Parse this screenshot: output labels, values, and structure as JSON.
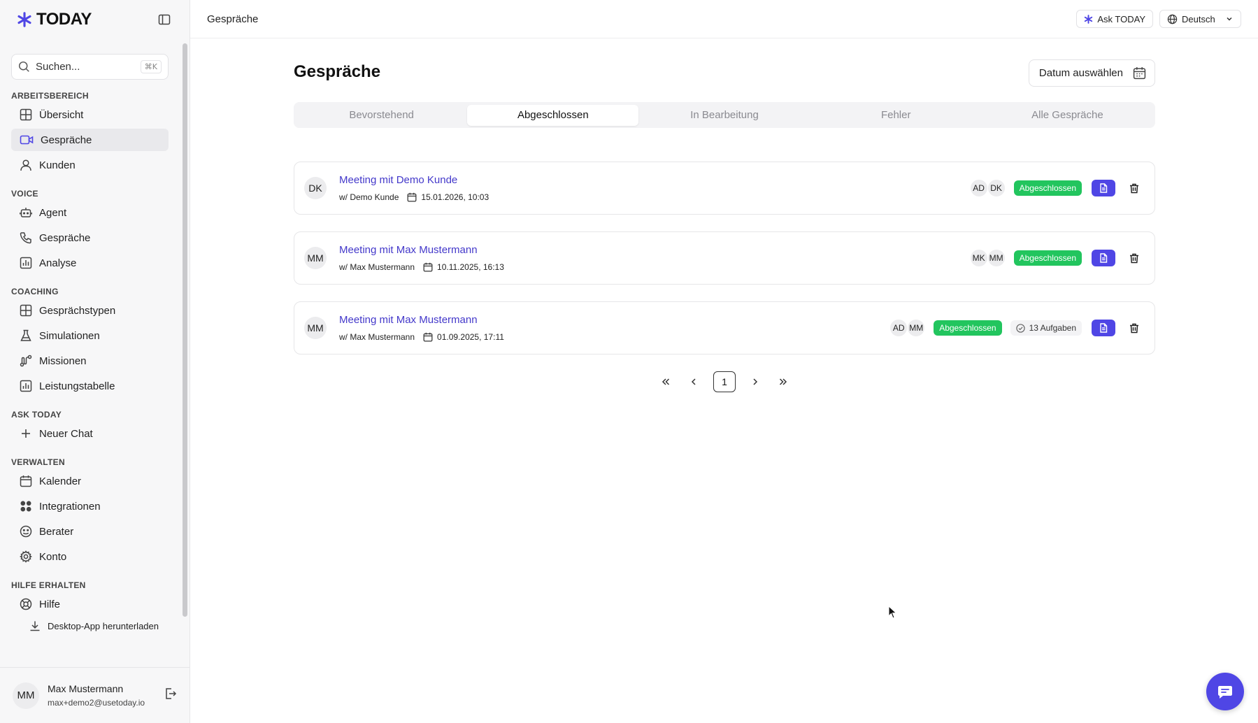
{
  "brand": {
    "name": "TODAY",
    "accent": "#4f46e5"
  },
  "topbar": {
    "breadcrumb": "Gespräche",
    "ask_label": "Ask TODAY",
    "language": "Deutsch"
  },
  "sidebar": {
    "search": {
      "placeholder": "Suchen...",
      "shortcut": "⌘K"
    },
    "sections": [
      {
        "title": "ARBEITSBEREICH",
        "items": [
          "Übersicht",
          "Gespräche",
          "Kunden"
        ]
      },
      {
        "title": "VOICE",
        "items": [
          "Agent",
          "Gespräche",
          "Analyse"
        ]
      },
      {
        "title": "COACHING",
        "items": [
          "Gesprächstypen",
          "Simulationen",
          "Missionen",
          "Leistungstabelle"
        ]
      },
      {
        "title": "ASK TODAY",
        "items": [
          "Neuer Chat"
        ]
      },
      {
        "title": "VERWALTEN",
        "items": [
          "Kalender",
          "Integrationen",
          "Berater",
          "Konto"
        ]
      },
      {
        "title": "HILFE ERHALTEN",
        "items": [
          "Hilfe",
          "Desktop-App herunterladen"
        ]
      }
    ],
    "user": {
      "initials": "MM",
      "name": "Max Mustermann",
      "email": "max+demo2@usetoday.io"
    }
  },
  "main": {
    "title": "Gespräche",
    "date_button": "Datum auswählen",
    "tabs": [
      "Bevorstehend",
      "Abgeschlossen",
      "In Bearbeitung",
      "Fehler",
      "Alle Gespräche"
    ],
    "active_tab": "Abgeschlossen",
    "meetings": [
      {
        "initials": "DK",
        "title": "Meeting mit Demo Kunde",
        "with": "w/ Demo Kunde",
        "datetime": "15.01.2026, 10:03",
        "participants": [
          "AD",
          "DK"
        ],
        "status": "Abgeschlossen",
        "tasks": ""
      },
      {
        "initials": "MM",
        "title": "Meeting mit Max Mustermann",
        "with": "w/ Max Mustermann",
        "datetime": "10.11.2025, 16:13",
        "participants": [
          "MK",
          "MM"
        ],
        "status": "Abgeschlossen",
        "tasks": ""
      },
      {
        "initials": "MM",
        "title": "Meeting mit Max Mustermann",
        "with": "w/ Max Mustermann",
        "datetime": "01.09.2025, 17:11",
        "participants": [
          "AD",
          "MM"
        ],
        "status": "Abgeschlossen",
        "tasks": "13 Aufgaben"
      }
    ],
    "pagination": {
      "current_page": "1"
    }
  }
}
